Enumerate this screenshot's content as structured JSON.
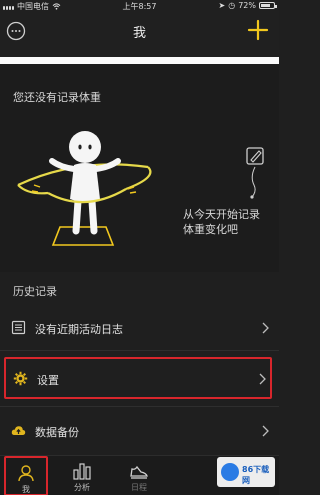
{
  "status_bar": {
    "carrier": "中国电信",
    "time": "上午8:57",
    "battery": "72%",
    "battery_level": 0.72
  },
  "header": {
    "title": "我",
    "left_icon": "message-icon",
    "right_icon": "plus-icon"
  },
  "weight_card": {
    "no_record_text": "您还没有记录体重",
    "start_text": "从今天开始记录体重变化吧",
    "edit_icon": "pencil-icon"
  },
  "history": {
    "title": "历史记录",
    "no_activity_label": "没有近期活动日志"
  },
  "menu": {
    "settings_label": "设置",
    "backup_label": "数据备份"
  },
  "tabs": {
    "me": "我",
    "analysis": "分析",
    "daily": "日程"
  },
  "watermark": {
    "text": "86下载网"
  },
  "colors": {
    "accent": "#f2c81e",
    "highlight": "#d8262c",
    "background": "#1f1f1f"
  }
}
